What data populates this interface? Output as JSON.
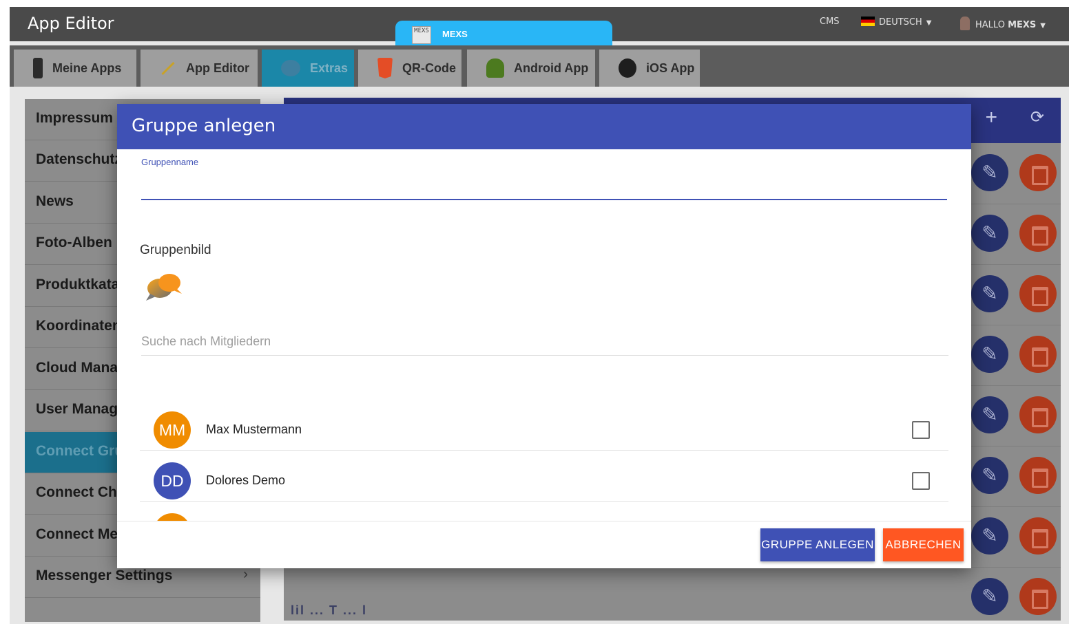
{
  "app": {
    "title": "App Editor",
    "brand_label": "MEXS",
    "brand_logo_text": "MEXS",
    "cms_label": "CMS",
    "language_label": "DEUTSCH",
    "greeting": "HALLO",
    "user_name": "MEXS"
  },
  "tabs": [
    {
      "label": "Meine Apps",
      "icon": "phone-icon"
    },
    {
      "label": "App Editor",
      "icon": "pencil-icon"
    },
    {
      "label": "Extras",
      "icon": "extras-icon"
    },
    {
      "label": "QR-Code",
      "icon": "html5-icon"
    },
    {
      "label": "Android App",
      "icon": "android-icon"
    },
    {
      "label": "iOS App",
      "icon": "apple-icon"
    }
  ],
  "sidebar": {
    "items": [
      {
        "label": "Impressum"
      },
      {
        "label": "Datenschutz"
      },
      {
        "label": "News"
      },
      {
        "label": "Foto-Alben"
      },
      {
        "label": "Produktkatalog"
      },
      {
        "label": "Koordinaten"
      },
      {
        "label": "Cloud Manager"
      },
      {
        "label": "User Management"
      },
      {
        "label": "Connect Gruppen"
      },
      {
        "label": "Connect Chats"
      },
      {
        "label": "Connect Messenger"
      },
      {
        "label": "Messenger Settings",
        "chevron": "›"
      }
    ]
  },
  "panel": {
    "add_icon": "+",
    "refresh_icon": "⟳",
    "peek_text": "lil ... T ... l"
  },
  "modal": {
    "title": "Gruppe anlegen",
    "name_label": "Gruppenname",
    "name_value": "",
    "image_label": "Gruppenbild",
    "search_placeholder": "Suche nach Mitgliedern",
    "members": [
      {
        "initials": "MM",
        "name": "Max Mustermann",
        "color": "#f08c00",
        "checked": false
      },
      {
        "initials": "DD",
        "name": "Dolores Demo",
        "color": "#3f51b5",
        "checked": false
      },
      {
        "initials": "",
        "name": "",
        "color": "#f08c00",
        "checked": false
      }
    ],
    "create_label": "GRUPPE ANLEGEN",
    "cancel_label": "ABBRECHEN"
  },
  "colors": {
    "primary": "#3f51b5",
    "accent": "#ff5722",
    "brand_tab": "#29b6f6"
  }
}
